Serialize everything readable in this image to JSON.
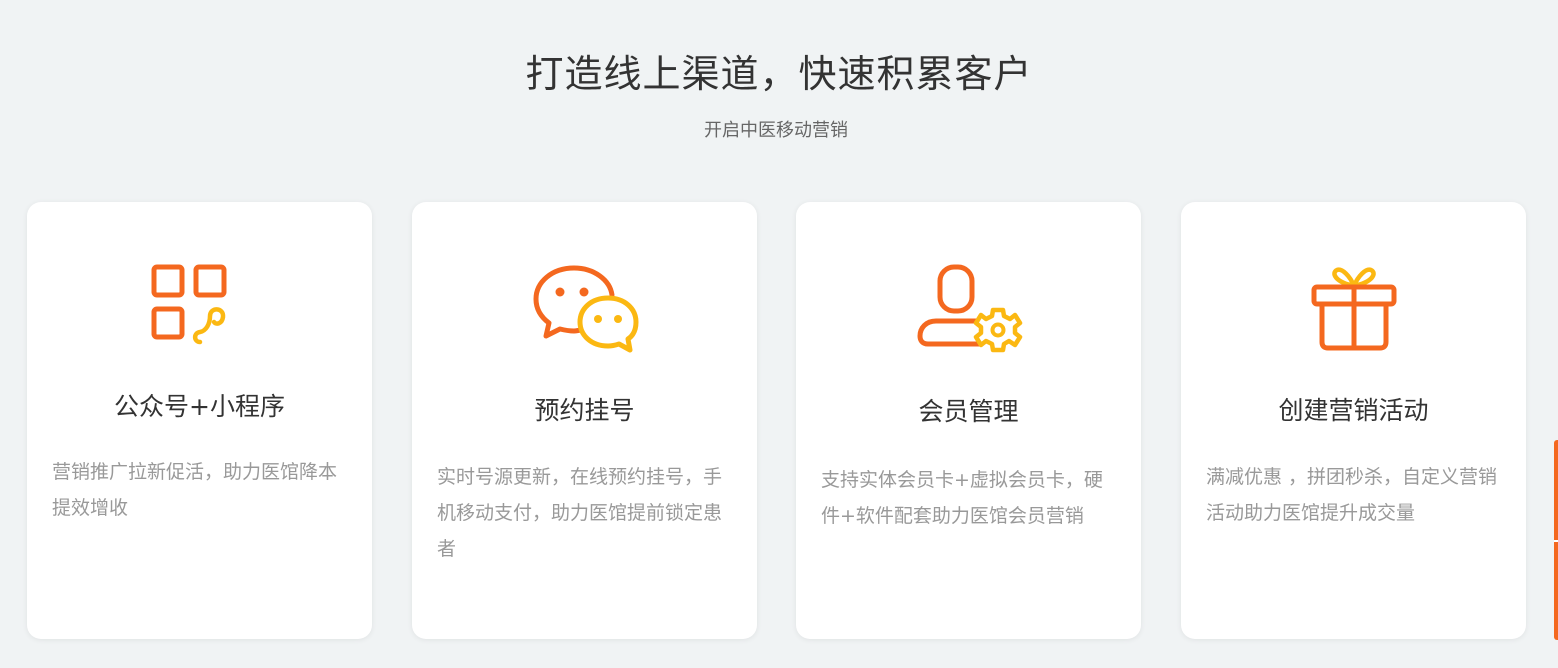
{
  "section": {
    "title": "打造线上渠道，快速积累客户",
    "subtitle": "开启中医移动营销"
  },
  "cards": [
    {
      "icon": "qrcode-miniprogram-icon",
      "title": "公众号+小程序",
      "description": "营销推广拉新促活，助力医馆降本提效增收"
    },
    {
      "icon": "wechat-chat-icon",
      "title": "预约挂号",
      "description": "实时号源更新，在线预约挂号，手机移动支付，助力医馆提前锁定患者"
    },
    {
      "icon": "member-settings-icon",
      "title": "会员管理",
      "description": "支持实体会员卡+虚拟会员卡，硬件+软件配套助力医馆会员营销"
    },
    {
      "icon": "gift-icon",
      "title": "创建营销活动",
      "description": "满减优惠 ，拼团秒杀，自定义营销活动助力医馆提升成交量"
    }
  ],
  "colors": {
    "background": "#f0f3f4",
    "card_background": "#ffffff",
    "accent_orange": "#f4681f",
    "accent_yellow": "#fbb812",
    "title_text": "#333333",
    "description_text": "#999999"
  }
}
